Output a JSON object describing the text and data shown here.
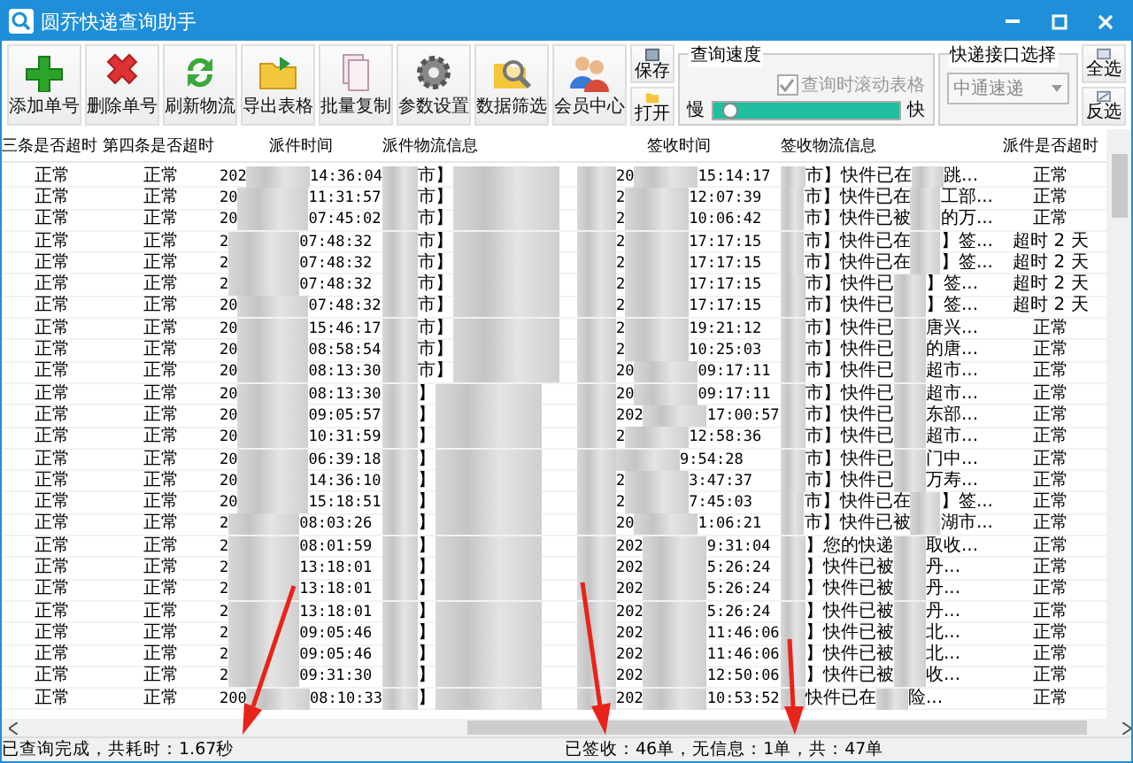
{
  "window": {
    "title": "圆乔快递查询助手"
  },
  "toolbar": [
    {
      "kind": "add",
      "label": "添加单号"
    },
    {
      "kind": "delete",
      "label": "删除单号"
    },
    {
      "kind": "refresh",
      "label": "刷新物流"
    },
    {
      "kind": "export",
      "label": "导出表格"
    },
    {
      "kind": "copy",
      "label": "批量复制"
    },
    {
      "kind": "settings",
      "label": "参数设置"
    },
    {
      "kind": "filter",
      "label": "数据筛选"
    },
    {
      "kind": "members",
      "label": "会员中心"
    }
  ],
  "file_buttons": [
    {
      "kind": "save",
      "label": "保存"
    },
    {
      "kind": "open",
      "label": "打开"
    }
  ],
  "speed": {
    "title": "查询速度",
    "scroll_checkbox": {
      "label": "查询时滚动表格",
      "checked": true,
      "disabled": true
    },
    "slow": "慢",
    "fast": "快",
    "level": 0.05
  },
  "interface": {
    "title": "快递接口选择",
    "value": "中通速递"
  },
  "select_buttons": [
    {
      "kind": "all",
      "label": "全选"
    },
    {
      "kind": "invert",
      "label": "反选"
    }
  ],
  "table": {
    "columns": [
      "三条是否超时",
      "第四条是否超时",
      "派件时间",
      "派件物流信息",
      "签收时间",
      "签收物流信息",
      "派件是否超时"
    ],
    "rows": [
      {
        "c1": "正常",
        "c2": "正常",
        "send_pre": "202",
        "send_time": "14:36:04",
        "send_info": "市】",
        "sign_pre": "20",
        "sign_time": "15:14:17",
        "sign_info": "市】快件已在",
        "sign_tail": "跳...",
        "overtime": "正常"
      },
      {
        "c1": "正常",
        "c2": "正常",
        "send_pre": "20",
        "send_time": "11:31:57",
        "send_info": "市】",
        "sign_pre": "2",
        "sign_time": "12:07:39",
        "sign_info": "市】快件已在",
        "sign_tail": "工部...",
        "overtime": "正常"
      },
      {
        "c1": "正常",
        "c2": "正常",
        "send_pre": "20",
        "send_time": "07:45:02",
        "send_info": "市】",
        "sign_pre": "2",
        "sign_time": "10:06:42",
        "sign_info": "市】快件已被",
        "sign_tail": "的万...",
        "overtime": "正常"
      },
      {
        "c1": "正常",
        "c2": "正常",
        "send_pre": "2",
        "send_time": "07:48:32",
        "send_info": "市】",
        "sign_pre": "2",
        "sign_time": "17:17:15",
        "sign_info": "市】快件已在",
        "sign_tail": "】签...",
        "overtime": "超时 2 天"
      },
      {
        "c1": "正常",
        "c2": "正常",
        "send_pre": "2",
        "send_time": "07:48:32",
        "send_info": "市】",
        "sign_pre": "2",
        "sign_time": "17:17:15",
        "sign_info": "市】快件已在",
        "sign_tail": "】签...",
        "overtime": "超时 2 天"
      },
      {
        "c1": "正常",
        "c2": "正常",
        "send_pre": "2",
        "send_time": "07:48:32",
        "send_info": "市】",
        "sign_pre": "2",
        "sign_time": "17:17:15",
        "sign_info": "市】快件已",
        "sign_tail": "】签...",
        "overtime": "超时 2 天"
      },
      {
        "c1": "正常",
        "c2": "正常",
        "send_pre": "20",
        "send_time": "07:48:32",
        "send_info": "市】",
        "sign_pre": "2",
        "sign_time": "17:17:15",
        "sign_info": "市】快件已",
        "sign_tail": "】签...",
        "overtime": "超时 2 天"
      },
      {
        "c1": "正常",
        "c2": "正常",
        "send_pre": "20",
        "send_time": "15:46:17",
        "send_info": "市】",
        "sign_pre": "2",
        "sign_time": "19:21:12",
        "sign_info": "市】快件已",
        "sign_tail": "唐兴...",
        "overtime": "正常"
      },
      {
        "c1": "正常",
        "c2": "正常",
        "send_pre": "20",
        "send_time": "08:58:54",
        "send_info": "市】",
        "sign_pre": "2",
        "sign_time": "10:25:03",
        "sign_info": "市】快件已",
        "sign_tail": "的唐...",
        "overtime": "正常"
      },
      {
        "c1": "正常",
        "c2": "正常",
        "send_pre": "20",
        "send_time": "08:13:30",
        "send_info": "市】",
        "sign_pre": "20",
        "sign_time": "09:17:11",
        "sign_info": "市】快件已",
        "sign_tail": "超市...",
        "overtime": "正常"
      },
      {
        "c1": "正常",
        "c2": "正常",
        "send_pre": "20",
        "send_time": "08:13:30",
        "send_info": "】",
        "sign_pre": "20",
        "sign_time": "09:17:11",
        "sign_info": "市】快件已",
        "sign_tail": "超市...",
        "overtime": "正常"
      },
      {
        "c1": "正常",
        "c2": "正常",
        "send_pre": "20",
        "send_time": "09:05:57",
        "send_info": "】",
        "sign_pre": "202",
        "sign_time": "17:00:57",
        "sign_info": "市】快件已",
        "sign_tail": "东部...",
        "overtime": "正常"
      },
      {
        "c1": "正常",
        "c2": "正常",
        "send_pre": "20",
        "send_time": "10:31:59",
        "send_info": "】",
        "sign_pre": "2",
        "sign_time": "12:58:36",
        "sign_info": "市】快件已",
        "sign_tail": "超市...",
        "overtime": "正常"
      },
      {
        "c1": "正常",
        "c2": "正常",
        "send_pre": "20",
        "send_time": "06:39:18",
        "send_info": "】",
        "sign_pre": "",
        "sign_time": "9:54:28",
        "sign_info": "市】快件已",
        "sign_tail": "门中...",
        "overtime": "正常"
      },
      {
        "c1": "正常",
        "c2": "正常",
        "send_pre": "20",
        "send_time": "14:36:10",
        "send_info": "】",
        "sign_pre": "2",
        "sign_time": "3:47:37",
        "sign_info": "市】快件已",
        "sign_tail": "万寿...",
        "overtime": "正常"
      },
      {
        "c1": "正常",
        "c2": "正常",
        "send_pre": "20",
        "send_time": "15:18:51",
        "send_info": "】",
        "sign_pre": "2",
        "sign_time": "7:45:03",
        "sign_info": "市】快件已在",
        "sign_tail": "】签...",
        "overtime": "正常"
      },
      {
        "c1": "正常",
        "c2": "正常",
        "send_pre": "2",
        "send_time": "08:03:26",
        "send_info": "】",
        "sign_pre": "20",
        "sign_time": "1:06:21",
        "sign_info": "市】快件已被",
        "sign_tail": "湖市...",
        "overtime": "正常"
      },
      {
        "c1": "正常",
        "c2": "正常",
        "send_pre": "2",
        "send_time": "08:01:59",
        "send_info": "】",
        "sign_pre": "202",
        "sign_time": "9:31:04",
        "sign_info": "】您的快递",
        "sign_tail": "取收...",
        "overtime": "正常"
      },
      {
        "c1": "正常",
        "c2": "正常",
        "send_pre": "2",
        "send_time": "13:18:01",
        "send_info": "】",
        "sign_pre": "202",
        "sign_time": "5:26:24",
        "sign_info": "】快件已被",
        "sign_tail": "丹...",
        "overtime": "正常"
      },
      {
        "c1": "正常",
        "c2": "正常",
        "send_pre": "2",
        "send_time": "13:18:01",
        "send_info": "】",
        "sign_pre": "202",
        "sign_time": "5:26:24",
        "sign_info": "】快件已被",
        "sign_tail": "丹...",
        "overtime": "正常"
      },
      {
        "c1": "正常",
        "c2": "正常",
        "send_pre": "2",
        "send_time": "13:18:01",
        "send_info": "】",
        "sign_pre": "202",
        "sign_time": "5:26:24",
        "sign_info": "】快件已被",
        "sign_tail": "丹...",
        "overtime": "正常"
      },
      {
        "c1": "正常",
        "c2": "正常",
        "send_pre": "2",
        "send_time": "09:05:46",
        "send_info": "】",
        "sign_pre": "202",
        "sign_time": "11:46:06",
        "sign_info": "】快件已被",
        "sign_tail": "北...",
        "overtime": "正常"
      },
      {
        "c1": "正常",
        "c2": "正常",
        "send_pre": "2",
        "send_time": "09:05:46",
        "send_info": "】",
        "sign_pre": "202",
        "sign_time": "11:46:06",
        "sign_info": "】快件已被",
        "sign_tail": "北...",
        "overtime": "正常"
      },
      {
        "c1": "正常",
        "c2": "正常",
        "send_pre": "2",
        "send_time": "09:31:30",
        "send_info": "】",
        "sign_pre": "202",
        "sign_time": "12:50:06",
        "sign_info": "】快件已被",
        "sign_tail": "收...",
        "overtime": "正常"
      },
      {
        "c1": "正常",
        "c2": "正常",
        "send_pre": "200",
        "send_time": "08:10:33",
        "send_info": "】",
        "sign_pre": "202",
        "sign_time": "10:53:52",
        "sign_info": "快件已在",
        "sign_tail": "险...",
        "overtime": "正常"
      }
    ]
  },
  "status_bar": {
    "left": "已查询完成，共耗时：1.67秒",
    "right": "已签收：46单，无信息：1单，共：47单"
  }
}
